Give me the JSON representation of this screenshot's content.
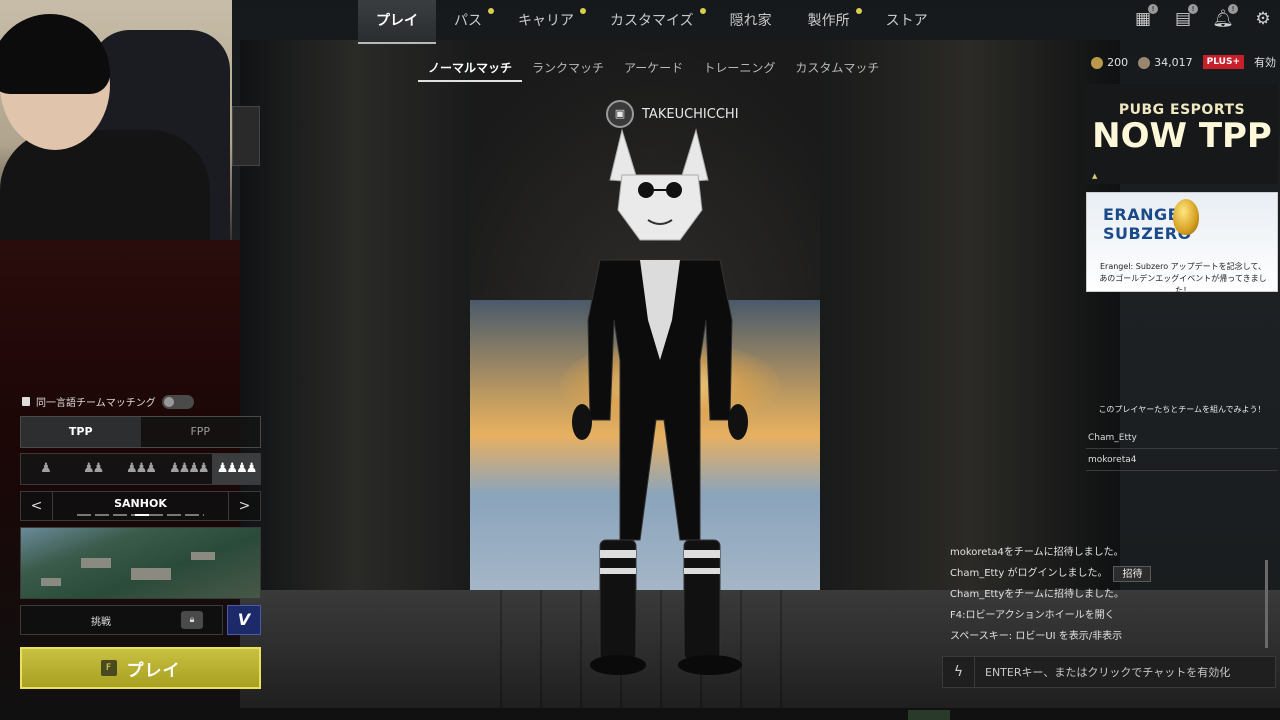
{
  "top_nav": {
    "items": [
      {
        "label": "プレイ",
        "active": true,
        "dot": false
      },
      {
        "label": "パス",
        "active": false,
        "dot": true
      },
      {
        "label": "キャリア",
        "active": false,
        "dot": true
      },
      {
        "label": "カスタマイズ",
        "active": false,
        "dot": true
      },
      {
        "label": "隠れ家",
        "active": false,
        "dot": false
      },
      {
        "label": "製作所",
        "active": false,
        "dot": true
      },
      {
        "label": "ストア",
        "active": false,
        "dot": false
      }
    ],
    "icons": [
      "inventory-icon",
      "missions-icon",
      "notification-icon",
      "settings-icon"
    ]
  },
  "sub_tabs": [
    "ノーマルマッチ",
    "ランクマッチ",
    "アーケード",
    "トレーニング",
    "カスタムマッチ"
  ],
  "currency": {
    "g_coin": "200",
    "bp": "34,017",
    "plus_badge": "PLUS+",
    "plus_status": "有効"
  },
  "player": {
    "name": "TAKEUCHICCHI"
  },
  "ads": {
    "esports": {
      "line1": "PUBG ESPORTS",
      "line2": "NOW TPP"
    },
    "erangel": {
      "title": "ERANGEL SUBZERO",
      "desc": "Erangel: Subzero アップデートを記念して、あのゴールデンエッグイベントが帰ってきました！"
    }
  },
  "team_suggest": {
    "heading": "このプレイヤーたちとチームを組んでみよう！",
    "players": [
      "Cham_Etty",
      "mokoreta4"
    ]
  },
  "left_panel": {
    "lang_match_label": "同一言語チームマッチング",
    "perspective": {
      "options": [
        "TPP",
        "FPP"
      ],
      "selected": "TPP"
    },
    "squad_sizes": [
      "solo",
      "duo",
      "trio",
      "squad",
      "custom-squad"
    ],
    "squad_selected": 4,
    "map": {
      "name": "SANHOK",
      "prev": "<",
      "next": ">"
    },
    "challenge_label": "挑戦",
    "v_label": "V",
    "play": {
      "key": "F",
      "label": "プレイ"
    }
  },
  "chat": {
    "lines": [
      {
        "text": "mokoreta4をチームに招待しました。",
        "button": ""
      },
      {
        "text": "Cham_Etty がログインしました。",
        "button": "招待"
      },
      {
        "text": "Cham_Ettyをチームに招待しました。",
        "button": ""
      },
      {
        "text": "F4:ロビーアクションホイールを開く",
        "button": ""
      },
      {
        "text": "スペースキー: ロビーUI を表示/非表示",
        "button": ""
      }
    ],
    "placeholder": "ENTERキー、またはクリックでチャットを有効化"
  },
  "colors": {
    "accent_play": "#c8c040",
    "plus_red": "#c8202a",
    "v_blue": "#1c2a6a"
  }
}
